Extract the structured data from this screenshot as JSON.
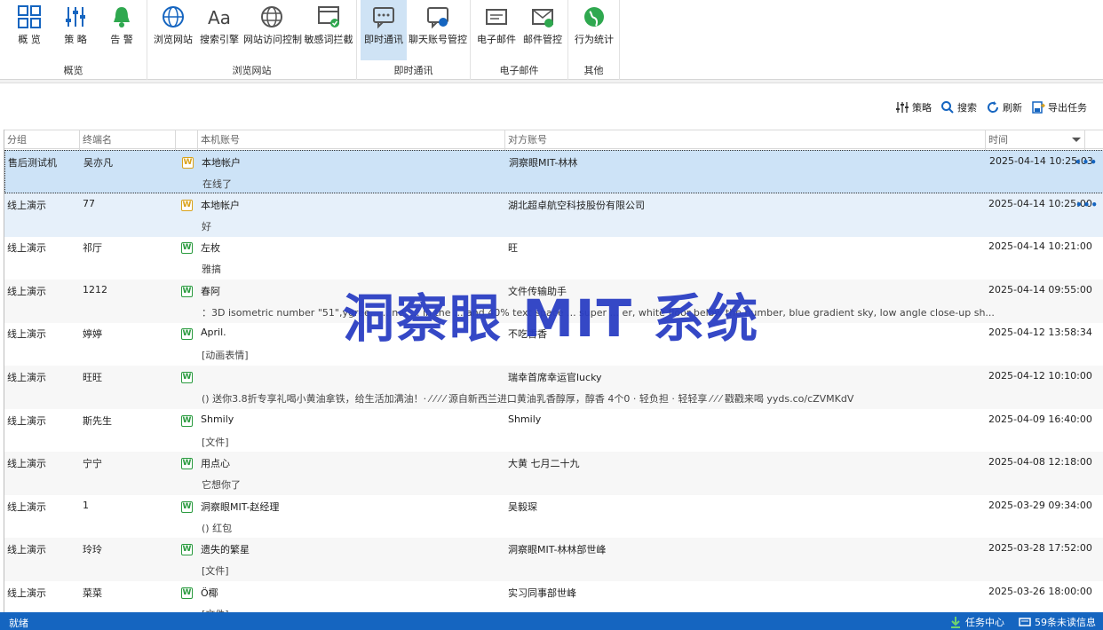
{
  "ribbon": {
    "groups": [
      {
        "label": "概览",
        "buttons": [
          {
            "label": "概 览",
            "icon": "overview-icon"
          },
          {
            "label": "策 略",
            "icon": "policy-sliders-icon"
          },
          {
            "label": "告 警",
            "icon": "bell-alert-icon"
          }
        ]
      },
      {
        "label": "浏览网站",
        "buttons": [
          {
            "label": "浏览网站",
            "icon": "globe-icon"
          },
          {
            "label": "搜索引擎",
            "icon": "font-aa-icon"
          },
          {
            "label": "网站访问控制",
            "icon": "globe-grid-icon"
          },
          {
            "label": "敏感词拦截",
            "icon": "window-check-icon"
          }
        ]
      },
      {
        "label": "即时通讯",
        "buttons": [
          {
            "label": "即时通讯",
            "icon": "chat-bubble-icon"
          },
          {
            "label": "聊天账号管控",
            "icon": "chat-user-icon"
          }
        ]
      },
      {
        "label": "电子邮件",
        "buttons": [
          {
            "label": "电子邮件",
            "icon": "email-icon"
          },
          {
            "label": "邮件管控",
            "icon": "email-check-icon"
          }
        ]
      },
      {
        "label": "其他",
        "buttons": [
          {
            "label": "行为统计",
            "icon": "globe-stats-icon"
          }
        ]
      }
    ],
    "active": "即时通讯"
  },
  "toolbar": {
    "policy": "策略",
    "search": "搜索",
    "refresh": "刷新",
    "export": "导出任务"
  },
  "table": {
    "headers": {
      "group": "分组",
      "terminal": "终端名",
      "local": "本机账号",
      "peer": "对方账号",
      "time": "时间"
    },
    "rows": [
      {
        "group": "售后测试机",
        "terminal": "吴亦凡",
        "local": "本地帐户",
        "peer": "洞察眼MIT-林林",
        "time": "2025-04-14 10:25:03",
        "msg": "在线了",
        "icon": "yellow"
      },
      {
        "group": "线上演示",
        "terminal": "77",
        "local": "本地帐户",
        "peer": "湖北超卓航空科技股份有限公司",
        "time": "2025-04-14 10:25:00",
        "msg": "好",
        "icon": "yellow"
      },
      {
        "group": "线上演示",
        "terminal": "祁厅",
        "local": "左枚",
        "peer": "旺",
        "time": "2025-04-14 10:21:00",
        "msg": "雅搞",
        "icon": "green"
      },
      {
        "group": "线上演示",
        "terminal": "1212",
        "local": "春阿",
        "peer": "文件传输助手",
        "time": "2025-04-14 09:55:00",
        "msg": "：3D isometric number \"51\",ygree... ...ne, ... in the ... and 40% text space ... super ... er, white floor below the number, blue gradient sky, low angle close-up sh...",
        "icon": "green"
      },
      {
        "group": "线上演示",
        "terminal": "婷婷",
        "local": "April.",
        "peer": "不吃香香",
        "time": "2025-04-12 13:58:34",
        "msg": "[动画表情]",
        "icon": "green"
      },
      {
        "group": "线上演示",
        "terminal": "旺旺",
        "local": "",
        "peer": "瑞幸首席幸运官lucky",
        "time": "2025-04-12 10:10:00",
        "msg": "() 送你3.8折专享礼喝小黄油拿铁，给生活加满油！· ⁄ ⁄ ⁄ ⁄ 源自新西兰进口黄油乳香醇厚，醇香 4个0 · 轻负担 · 轻轻享 ⁄ ⁄ ⁄ 戳戳来喝 yyds.co/cZVMKdV",
        "icon": "green"
      },
      {
        "group": "线上演示",
        "terminal": "斯先生",
        "local": "Shmily",
        "peer": "Shmily",
        "time": "2025-04-09 16:40:00",
        "msg": "[文件]",
        "icon": "green"
      },
      {
        "group": "线上演示",
        "terminal": "宁宁",
        "local": "用点心",
        "peer": "大黄 七月二十九",
        "time": "2025-04-08 12:18:00",
        "msg": "它想你了",
        "icon": "green"
      },
      {
        "group": "线上演示",
        "terminal": "1",
        "local": "洞察眼MIT-赵经理",
        "peer": "吴毅琛",
        "time": "2025-03-29 09:34:00",
        "msg": "() 红包",
        "icon": "green"
      },
      {
        "group": "线上演示",
        "terminal": "玲玲",
        "local": "遗失的繁星",
        "peer": "洞察眼MIT-林林部世峰",
        "time": "2025-03-28 17:52:00",
        "msg": "[文件]",
        "icon": "green"
      },
      {
        "group": "线上演示",
        "terminal": "菜菜",
        "local": "Ö椰",
        "peer": "实习同事部世峰",
        "time": "2025-03-26 18:00:00",
        "msg": "[文件]",
        "icon": "green"
      }
    ]
  },
  "watermark": "洞察眼 MIT 系统",
  "status": {
    "left": "就绪",
    "task_center": "任务中心",
    "unread": "59条未读信息"
  },
  "colors": {
    "accent": "#1565c0",
    "selected": "#cde3f7",
    "watermark": "#2b3fc4",
    "wechat_green": "#2a9b3f"
  }
}
